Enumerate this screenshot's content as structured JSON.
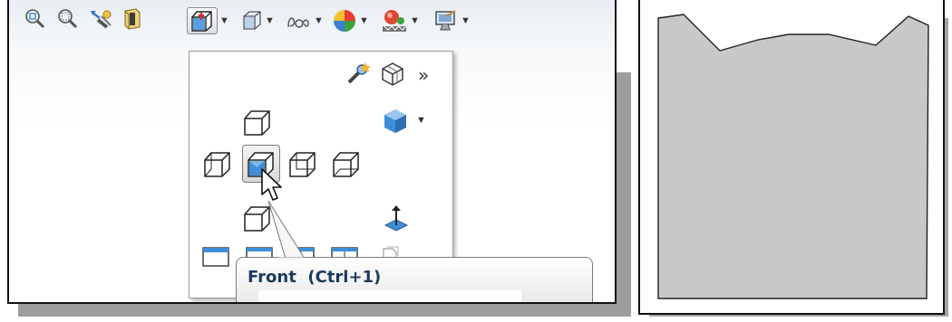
{
  "tooltip": {
    "title": "Front",
    "shortcut": "(Ctrl+1)"
  },
  "toolbar": {
    "icons": [
      "zoom-to-fit-icon",
      "zoom-to-area-icon",
      "previous-view-icon",
      "section-view-icon",
      "view-orientation-icon",
      "display-style-icon",
      "hide-show-items-icon",
      "edit-appearance-icon",
      "apply-scene-icon",
      "view-settings-icon"
    ]
  },
  "view_orientation_menu": {
    "selected": "Front",
    "items": [
      "new-view",
      "view-selector",
      "more",
      "top",
      "isometric",
      "left",
      "front",
      "right",
      "back",
      "bottom",
      "normal-to",
      "single-view",
      "two-view-horizontal",
      "two-view-vertical",
      "four-view",
      "link-views"
    ]
  },
  "colors": {
    "accent_blue": "#3f8ed8",
    "tooltip_text": "#1b3a5c",
    "part_fill": "#c8c8c8"
  }
}
